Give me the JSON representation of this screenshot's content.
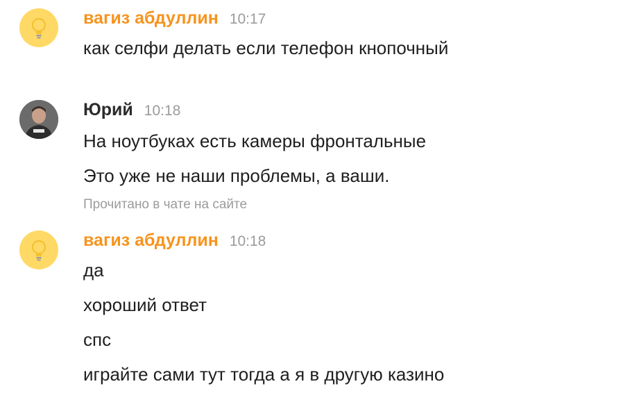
{
  "messages": [
    {
      "author": "вагиз абдуллин",
      "time": "10:17",
      "avatar": "lightbulb-icon",
      "lines": [
        "как селфи делать если телефон кнопочный"
      ]
    },
    {
      "author": "Юрий",
      "time": "10:18",
      "avatar": "user-photo",
      "lines": [
        "На ноутбуках есть камеры фронтальные",
        "Это уже не наши проблемы, а ваши."
      ],
      "status": "Прочитано в чате на сайте"
    },
    {
      "author": "вагиз абдуллин",
      "time": "10:18",
      "avatar": "lightbulb-icon",
      "lines": [
        "да",
        "хороший ответ",
        "спс",
        "играйте сами тут тогда а я в другую казино"
      ]
    }
  ],
  "colors": {
    "author_orange": "#f7931e",
    "time_gray": "#9b9b9b",
    "avatar_yellow": "#ffd966"
  }
}
